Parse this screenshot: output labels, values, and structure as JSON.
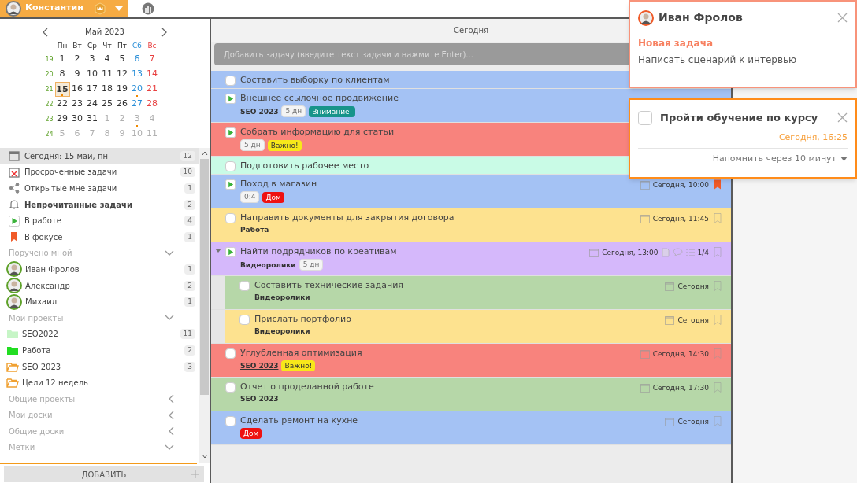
{
  "user": {
    "name": "Константин"
  },
  "calendar": {
    "month": "Май 2023",
    "weekdays": [
      {
        "text": "Пн",
        "kind": "weekday"
      },
      {
        "text": "Вт",
        "kind": "weekday"
      },
      {
        "text": "Ср",
        "kind": "weekday"
      },
      {
        "text": "Чт",
        "kind": "weekday"
      },
      {
        "text": "Пт",
        "kind": "weekday"
      },
      {
        "text": "Сб",
        "kind": "saturday"
      },
      {
        "text": "Вс",
        "kind": "sunday"
      }
    ],
    "weeks": [
      {
        "number": "19",
        "days": [
          {
            "text": "1",
            "kind": "weekday",
            "selected": false,
            "marked": false
          },
          {
            "text": "2",
            "kind": "weekday",
            "selected": false,
            "marked": false
          },
          {
            "text": "3",
            "kind": "weekday",
            "selected": false,
            "marked": false
          },
          {
            "text": "4",
            "kind": "weekday",
            "selected": false,
            "marked": false
          },
          {
            "text": "5",
            "kind": "weekday",
            "selected": false,
            "marked": false
          },
          {
            "text": "6",
            "kind": "saturday",
            "selected": false,
            "marked": false
          },
          {
            "text": "7",
            "kind": "sunday",
            "selected": false,
            "marked": false
          }
        ]
      },
      {
        "number": "20",
        "days": [
          {
            "text": "8",
            "kind": "weekday",
            "selected": false,
            "marked": false
          },
          {
            "text": "9",
            "kind": "weekday",
            "selected": false,
            "marked": false
          },
          {
            "text": "10",
            "kind": "weekday",
            "selected": false,
            "marked": false
          },
          {
            "text": "11",
            "kind": "weekday",
            "selected": false,
            "marked": false
          },
          {
            "text": "12",
            "kind": "weekday",
            "selected": false,
            "marked": false
          },
          {
            "text": "13",
            "kind": "saturday",
            "selected": false,
            "marked": false
          },
          {
            "text": "14",
            "kind": "sunday",
            "selected": false,
            "marked": false
          }
        ]
      },
      {
        "number": "21",
        "days": [
          {
            "text": "15",
            "kind": "weekday",
            "selected": true,
            "marked": true
          },
          {
            "text": "16",
            "kind": "weekday",
            "selected": false,
            "marked": false
          },
          {
            "text": "17",
            "kind": "weekday",
            "selected": false,
            "marked": false
          },
          {
            "text": "18",
            "kind": "weekday",
            "selected": false,
            "marked": false
          },
          {
            "text": "19",
            "kind": "weekday",
            "selected": false,
            "marked": false
          },
          {
            "text": "20",
            "kind": "saturday",
            "selected": false,
            "marked": true
          },
          {
            "text": "21",
            "kind": "sunday",
            "selected": false,
            "marked": false
          }
        ]
      },
      {
        "number": "22",
        "days": [
          {
            "text": "22",
            "kind": "weekday",
            "selected": false,
            "marked": false
          },
          {
            "text": "23",
            "kind": "weekday",
            "selected": false,
            "marked": false
          },
          {
            "text": "24",
            "kind": "weekday",
            "selected": false,
            "marked": false
          },
          {
            "text": "25",
            "kind": "weekday",
            "selected": false,
            "marked": false
          },
          {
            "text": "26",
            "kind": "weekday",
            "selected": false,
            "marked": false
          },
          {
            "text": "27",
            "kind": "saturday",
            "selected": false,
            "marked": false
          },
          {
            "text": "28",
            "kind": "sunday",
            "selected": false,
            "marked": false
          }
        ]
      },
      {
        "number": "23",
        "days": [
          {
            "text": "29",
            "kind": "weekday",
            "selected": false,
            "marked": false
          },
          {
            "text": "30",
            "kind": "weekday",
            "selected": false,
            "marked": false
          },
          {
            "text": "31",
            "kind": "weekday",
            "selected": false,
            "marked": false
          },
          {
            "text": "1",
            "kind": "other",
            "selected": false,
            "marked": false
          },
          {
            "text": "2",
            "kind": "other",
            "selected": false,
            "marked": false
          },
          {
            "text": "3",
            "kind": "other",
            "selected": false,
            "marked": true
          },
          {
            "text": "4",
            "kind": "other",
            "selected": false,
            "marked": false
          }
        ]
      },
      {
        "number": "24",
        "days": [
          {
            "text": "5",
            "kind": "other",
            "selected": false,
            "marked": false
          },
          {
            "text": "6",
            "kind": "other",
            "selected": false,
            "marked": false
          },
          {
            "text": "7",
            "kind": "other",
            "selected": false,
            "marked": false
          },
          {
            "text": "8",
            "kind": "other",
            "selected": false,
            "marked": false
          },
          {
            "text": "9",
            "kind": "other",
            "selected": false,
            "marked": false
          },
          {
            "text": "10",
            "kind": "other",
            "selected": false,
            "marked": false
          },
          {
            "text": "11",
            "kind": "other",
            "selected": false,
            "marked": false
          }
        ]
      }
    ]
  },
  "nav": [
    {
      "kind": "today",
      "label": "Сегодня: 15 май, пн",
      "count": "12",
      "selected": true,
      "unread": false
    },
    {
      "kind": "overdue",
      "label": "Просроченные задачи",
      "count": "10",
      "selected": false,
      "unread": false
    },
    {
      "kind": "shared",
      "label": "Открытые мне задачи",
      "count": "1",
      "selected": false,
      "unread": false
    },
    {
      "kind": "bell",
      "label": "Непрочитанные задачи",
      "count": "2",
      "selected": false,
      "unread": true
    },
    {
      "kind": "in_progress",
      "label": "В работе",
      "count": "4",
      "selected": false,
      "unread": false
    },
    {
      "kind": "focus",
      "label": "В фокусе",
      "count": "1",
      "selected": false,
      "unread": false
    }
  ],
  "sections": [
    {
      "title": "Поручено мной",
      "expanded": true,
      "items": [
        {
          "kind": "person",
          "label": "Иван Фролов",
          "count": "1"
        },
        {
          "kind": "person",
          "label": "Александр",
          "count": "2"
        },
        {
          "kind": "person",
          "label": "Михаил",
          "count": "1"
        }
      ]
    },
    {
      "title": "Мои проекты",
      "expanded": true,
      "items": [
        {
          "kind": "folder",
          "label": "SEO2022",
          "count": "11",
          "color": "#c6f5c6"
        },
        {
          "kind": "folder",
          "label": "Работа",
          "count": "2",
          "color": "#22dd22"
        },
        {
          "kind": "folder_open",
          "label": "SEO 2023",
          "count": "3",
          "color": "#f0a030"
        },
        {
          "kind": "folder_open",
          "label": "Цели 12 недель",
          "color": "#f0a030"
        }
      ]
    },
    {
      "title": "Общие проекты",
      "expanded": false
    },
    {
      "title": "Мои доски",
      "expanded": false
    },
    {
      "title": "Общие доски",
      "expanded": false
    },
    {
      "title": "Метки",
      "expanded": true
    }
  ],
  "add_button": "ДОБАВИТЬ",
  "main": {
    "title": "Сегодня",
    "add_placeholder": "Добавить задачу (введите текст задачи и нажмите Enter)...",
    "tasks": [
      {
        "kind": "check",
        "title": "Составить выборку по клиентам",
        "color": "#a4c2f4"
      },
      {
        "kind": "play",
        "title": "Внешнее ссылочное продвижение",
        "color": "#a4c2f4",
        "project": "SEO 2023",
        "duration": "5 дн",
        "tags": [
          {
            "text": "Внимание!",
            "color": "#17948a"
          }
        ]
      },
      {
        "kind": "play",
        "title": "Собрать информацию для статьи",
        "color": "#f8837d",
        "duration": "5 дн",
        "tags": [
          {
            "text": "Важно!",
            "color": "#f7e81a"
          }
        ]
      },
      {
        "kind": "check",
        "title": "Подготовить рабочее место",
        "color": "#c9fbe6"
      },
      {
        "kind": "play",
        "title": "Поход в магазин",
        "color": "#a4c2f4",
        "duration": "0:4",
        "tags": [
          {
            "text": "Дом",
            "color": "#ee1111"
          }
        ],
        "date": "Сегодня, 10:00",
        "bookmarked": true
      },
      {
        "kind": "check",
        "title": "Направить документы для закрытия договора",
        "color": "#fde28f",
        "project": "Работа",
        "date": "Сегодня, 11:45",
        "bookmarked": false
      },
      {
        "kind": "play",
        "title": "Найти подрядчиков по креативам",
        "color": "#d5b8fb",
        "project": "Видеоролики",
        "duration": "5 дн",
        "date": "Сегодня, 13:00",
        "note": true,
        "comment": true,
        "checklist": "1/4",
        "bookmarked": false,
        "expanded": true,
        "children": [
          {
            "kind": "check",
            "title": "Составить технические задания",
            "color": "#b6d7a8",
            "project": "Видеоролики",
            "date": "Сегодня",
            "bookmarked": false
          },
          {
            "kind": "check",
            "title": "Прислать портфолио",
            "color": "#fde28f",
            "project": "Видеоролики",
            "date": "Сегодня",
            "bookmarked": false
          }
        ]
      },
      {
        "kind": "check",
        "title": "Углубленная оптимизация",
        "color": "#f8837d",
        "project": "SEO 2023",
        "project_underlined": true,
        "tags": [
          {
            "text": "Важно!",
            "color": "#f7e81a"
          }
        ],
        "date": "Сегодня, 14:30",
        "bookmarked": false
      },
      {
        "kind": "check",
        "title": "Отчет о проделанной работе",
        "color": "#b6d7a8",
        "project": "SEO 2023",
        "date": "Сегодня, 17:30",
        "bookmarked": false
      },
      {
        "kind": "check",
        "title": "Сделать ремонт на кухне",
        "color": "#a4c2f4",
        "tags": [
          {
            "text": "Дом",
            "color": "#ee1111"
          }
        ],
        "date": "Сегодня",
        "bookmarked": false
      }
    ]
  },
  "notifications": [
    {
      "kind": "message",
      "author": "Иван Фролов",
      "type": "Новая задача",
      "text": "Написать сценарий к интервью"
    },
    {
      "kind": "reminder",
      "title": "Пройти обучение по курсу",
      "checked": false,
      "time": "Сегодня, 16:25",
      "remind": "Напомнить через 10 минут"
    }
  ]
}
